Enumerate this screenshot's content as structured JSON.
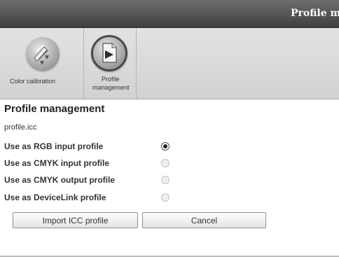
{
  "window": {
    "title": "Profile m"
  },
  "toolbar": {
    "tools": [
      {
        "label": "Color calibration",
        "icon": "color-calibration-icon",
        "selected": false
      },
      {
        "label_line1": "Profile",
        "label_line2": "management",
        "icon": "profile-management-icon",
        "selected": true
      }
    ]
  },
  "main": {
    "heading": "Profile management",
    "filename": "profile.icc",
    "options": [
      {
        "label": "Use as RGB input profile",
        "checked": true
      },
      {
        "label": "Use as CMYK input profile",
        "checked": false
      },
      {
        "label": "Use as CMYK output profile",
        "checked": false
      },
      {
        "label": "Use as DeviceLink profile",
        "checked": false
      }
    ],
    "buttons": {
      "import": "Import ICC profile",
      "cancel": "Cancel"
    }
  },
  "colors": {
    "titlebar": "#4f4f4f",
    "toolbar": "#d9d9d9",
    "background": "#ffffff"
  }
}
